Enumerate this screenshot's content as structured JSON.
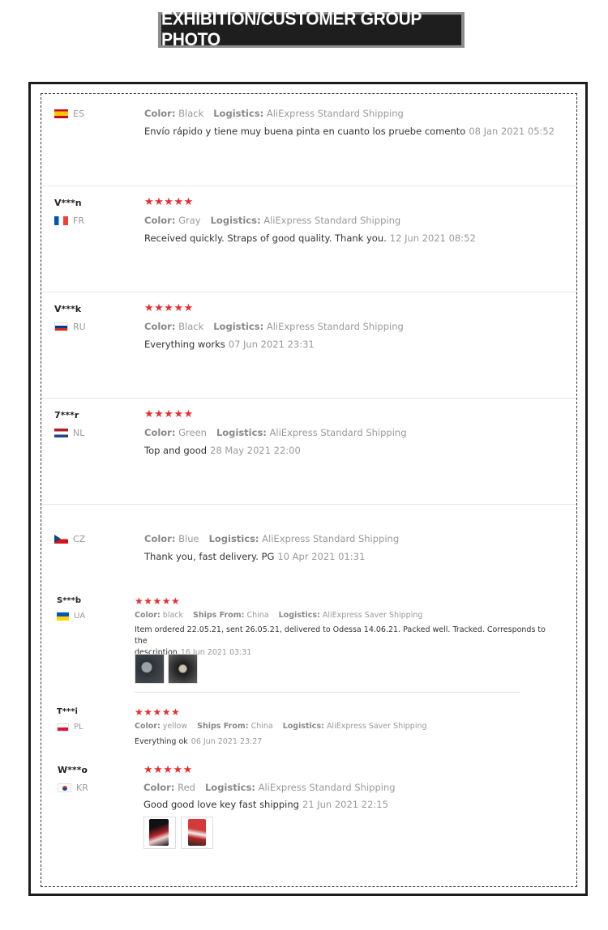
{
  "banner": {
    "title": "EXHIBITION/CUSTOMER GROUP PHOTO"
  },
  "labels": {
    "color": "Color:",
    "logistics": "Logistics:",
    "ships_from": "Ships From:"
  },
  "stars": "★★★★★",
  "reviews": [
    {
      "user": "",
      "country": "ES",
      "color": "Black",
      "logistics": "AliExpress Standard Shipping",
      "text": "Envío rápido y tiene muy buena pinta en cuanto los pruebe comento",
      "date": "08 Jan 2021 05:52"
    },
    {
      "user": "V***n",
      "country": "FR",
      "color": "Gray",
      "logistics": "AliExpress Standard Shipping",
      "text": "Received quickly. Straps of good quality. Thank you.",
      "date": "12 Jun 2021 08:52"
    },
    {
      "user": "V***k",
      "country": "RU",
      "color": "Black",
      "logistics": "AliExpress Standard Shipping",
      "text": "Everything works",
      "date": "07 Jun 2021 23:31"
    },
    {
      "user": "7***r",
      "country": "NL",
      "color": "Green",
      "logistics": "AliExpress Standard Shipping",
      "text": "Top and good",
      "date": "28 May 2021 22:00"
    },
    {
      "user": "",
      "country": "CZ",
      "color": "Blue",
      "logistics": "AliExpress Standard Shipping",
      "text": "Thank you, fast delivery. PG",
      "date": "10 Apr 2021 01:31"
    },
    {
      "user": "S***b",
      "country": "UA",
      "color": "black",
      "ships_from": "China",
      "logistics": "AliExpress Saver Shipping",
      "text_line1": "Item ordered 22.05.21, sent 26.05.21, delivered to Odessa 14.06.21. Packed well. Tracked. Corresponds to the",
      "text_line2": "description",
      "date": "16 Jun 2021 03:31"
    },
    {
      "user": "T***i",
      "country": "PL",
      "color": "yellow",
      "ships_from": "China",
      "logistics": "AliExpress Saver Shipping",
      "text": "Everything ok",
      "date": "06 Jun 2021 23:27"
    },
    {
      "user": "W***o",
      "country": "KR",
      "color": "Red",
      "logistics": "AliExpress Standard Shipping",
      "text": "Good good love key fast shipping",
      "date": "21 Jun 2021 22:15"
    }
  ],
  "colors": {
    "star": "#e62e2e",
    "meta": "#999999",
    "border": "#1c1c1c"
  }
}
